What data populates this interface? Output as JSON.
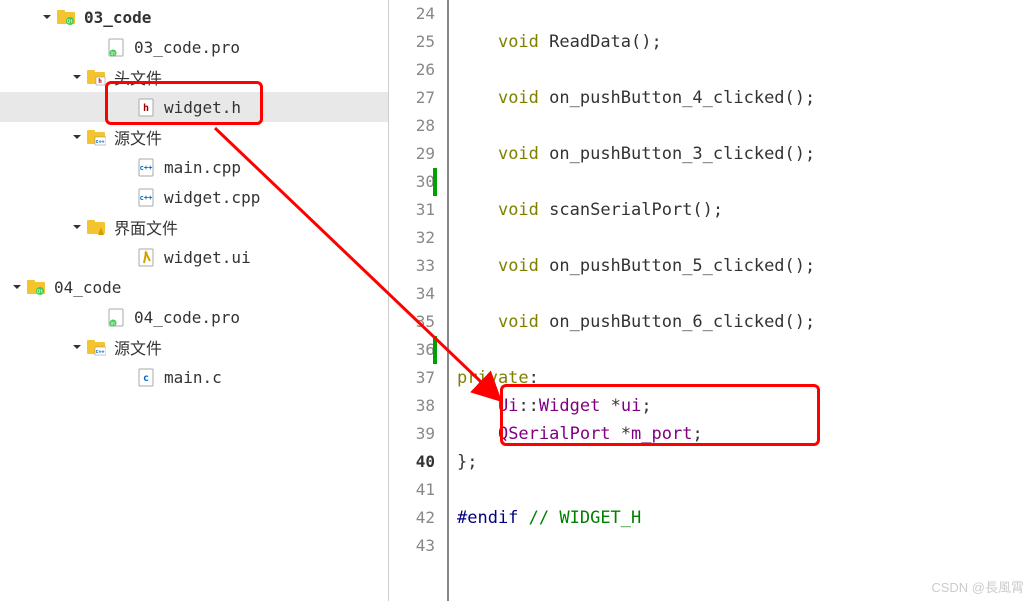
{
  "tree": {
    "items": [
      {
        "indent": 40,
        "arrow": true,
        "icon": "folder-qt",
        "label": "03_code",
        "bold": true
      },
      {
        "indent": 90,
        "arrow": false,
        "icon": "file-pro",
        "label": "03_code.pro"
      },
      {
        "indent": 70,
        "arrow": true,
        "icon": "folder-h",
        "label": "头文件"
      },
      {
        "indent": 120,
        "arrow": false,
        "icon": "file-h",
        "label": "widget.h",
        "selected": true
      },
      {
        "indent": 70,
        "arrow": true,
        "icon": "folder-cpp",
        "label": "源文件"
      },
      {
        "indent": 120,
        "arrow": false,
        "icon": "file-cpp",
        "label": "main.cpp"
      },
      {
        "indent": 120,
        "arrow": false,
        "icon": "file-cpp",
        "label": "widget.cpp"
      },
      {
        "indent": 70,
        "arrow": true,
        "icon": "folder-ui",
        "label": "界面文件"
      },
      {
        "indent": 120,
        "arrow": false,
        "icon": "file-ui",
        "label": "widget.ui"
      },
      {
        "indent": 10,
        "arrow": true,
        "icon": "folder-qt",
        "label": "04_code"
      },
      {
        "indent": 90,
        "arrow": false,
        "icon": "file-pro",
        "label": "04_code.pro"
      },
      {
        "indent": 70,
        "arrow": true,
        "icon": "folder-cpp",
        "label": "源文件"
      },
      {
        "indent": 120,
        "arrow": false,
        "icon": "file-c",
        "label": "main.c"
      }
    ]
  },
  "code": {
    "lines": [
      {
        "num": "24",
        "tokens": [
          {
            "t": "",
            "c": ""
          }
        ]
      },
      {
        "num": "25",
        "tokens": [
          {
            "t": "    ",
            "c": ""
          },
          {
            "t": "void",
            "c": "kw"
          },
          {
            "t": " ReadData();",
            "c": ""
          }
        ]
      },
      {
        "num": "26",
        "tokens": [
          {
            "t": "",
            "c": ""
          }
        ]
      },
      {
        "num": "27",
        "tokens": [
          {
            "t": "    ",
            "c": ""
          },
          {
            "t": "void",
            "c": "kw"
          },
          {
            "t": " on_pushButton_4_clicked();",
            "c": ""
          }
        ]
      },
      {
        "num": "28",
        "tokens": [
          {
            "t": "",
            "c": ""
          }
        ]
      },
      {
        "num": "29",
        "tokens": [
          {
            "t": "    ",
            "c": ""
          },
          {
            "t": "void",
            "c": "kw"
          },
          {
            "t": " on_pushButton_3_clicked();",
            "c": ""
          }
        ]
      },
      {
        "num": "30",
        "green": true,
        "hl": true,
        "tokens": [
          {
            "t": "",
            "c": ""
          }
        ]
      },
      {
        "num": "31",
        "green": true,
        "tokens": [
          {
            "t": "    ",
            "c": ""
          },
          {
            "t": "void",
            "c": "kw"
          },
          {
            "t": " scanSerialPort();",
            "c": ""
          }
        ]
      },
      {
        "num": "32",
        "green": true,
        "tokens": [
          {
            "t": "",
            "c": ""
          }
        ]
      },
      {
        "num": "33",
        "green": true,
        "tokens": [
          {
            "t": "    ",
            "c": ""
          },
          {
            "t": "void",
            "c": "kw"
          },
          {
            "t": " on_pushButton_5_clicked();",
            "c": ""
          }
        ]
      },
      {
        "num": "34",
        "green": true,
        "tokens": [
          {
            "t": "",
            "c": ""
          }
        ]
      },
      {
        "num": "35",
        "green": true,
        "tokens": [
          {
            "t": "    ",
            "c": ""
          },
          {
            "t": "void",
            "c": "kw"
          },
          {
            "t": " on_pushButton_6_clicked();",
            "c": ""
          }
        ]
      },
      {
        "num": "36",
        "green": true,
        "hl": true,
        "tokens": [
          {
            "t": "",
            "c": ""
          }
        ]
      },
      {
        "num": "37",
        "green": true,
        "tokens": [
          {
            "t": "",
            "c": ""
          },
          {
            "t": "private",
            "c": "kw"
          },
          {
            "t": ":",
            "c": ""
          }
        ]
      },
      {
        "num": "38",
        "tokens": [
          {
            "t": "    ",
            "c": ""
          },
          {
            "t": "Ui",
            "c": "type"
          },
          {
            "t": "::",
            "c": ""
          },
          {
            "t": "Widget",
            "c": "type"
          },
          {
            "t": " *",
            "c": ""
          },
          {
            "t": "ui",
            "c": "type"
          },
          {
            "t": ";",
            "c": ""
          }
        ]
      },
      {
        "num": "39",
        "tokens": [
          {
            "t": "    ",
            "c": ""
          },
          {
            "t": "QSerialPort",
            "c": "type"
          },
          {
            "t": " *",
            "c": ""
          },
          {
            "t": "m_port",
            "c": "type"
          },
          {
            "t": ";",
            "c": ""
          }
        ]
      },
      {
        "num": "40",
        "bold": true,
        "tokens": [
          {
            "t": "};",
            "c": ""
          }
        ]
      },
      {
        "num": "41",
        "tokens": [
          {
            "t": "",
            "c": ""
          }
        ]
      },
      {
        "num": "42",
        "tokens": [
          {
            "t": "",
            "c": ""
          },
          {
            "t": "#endif",
            "c": "preproc"
          },
          {
            "t": " ",
            "c": ""
          },
          {
            "t": "// WIDGET_H",
            "c": "comment"
          }
        ]
      },
      {
        "num": "43",
        "tokens": [
          {
            "t": "",
            "c": ""
          }
        ]
      }
    ]
  },
  "watermark": "CSDN @長風霄"
}
